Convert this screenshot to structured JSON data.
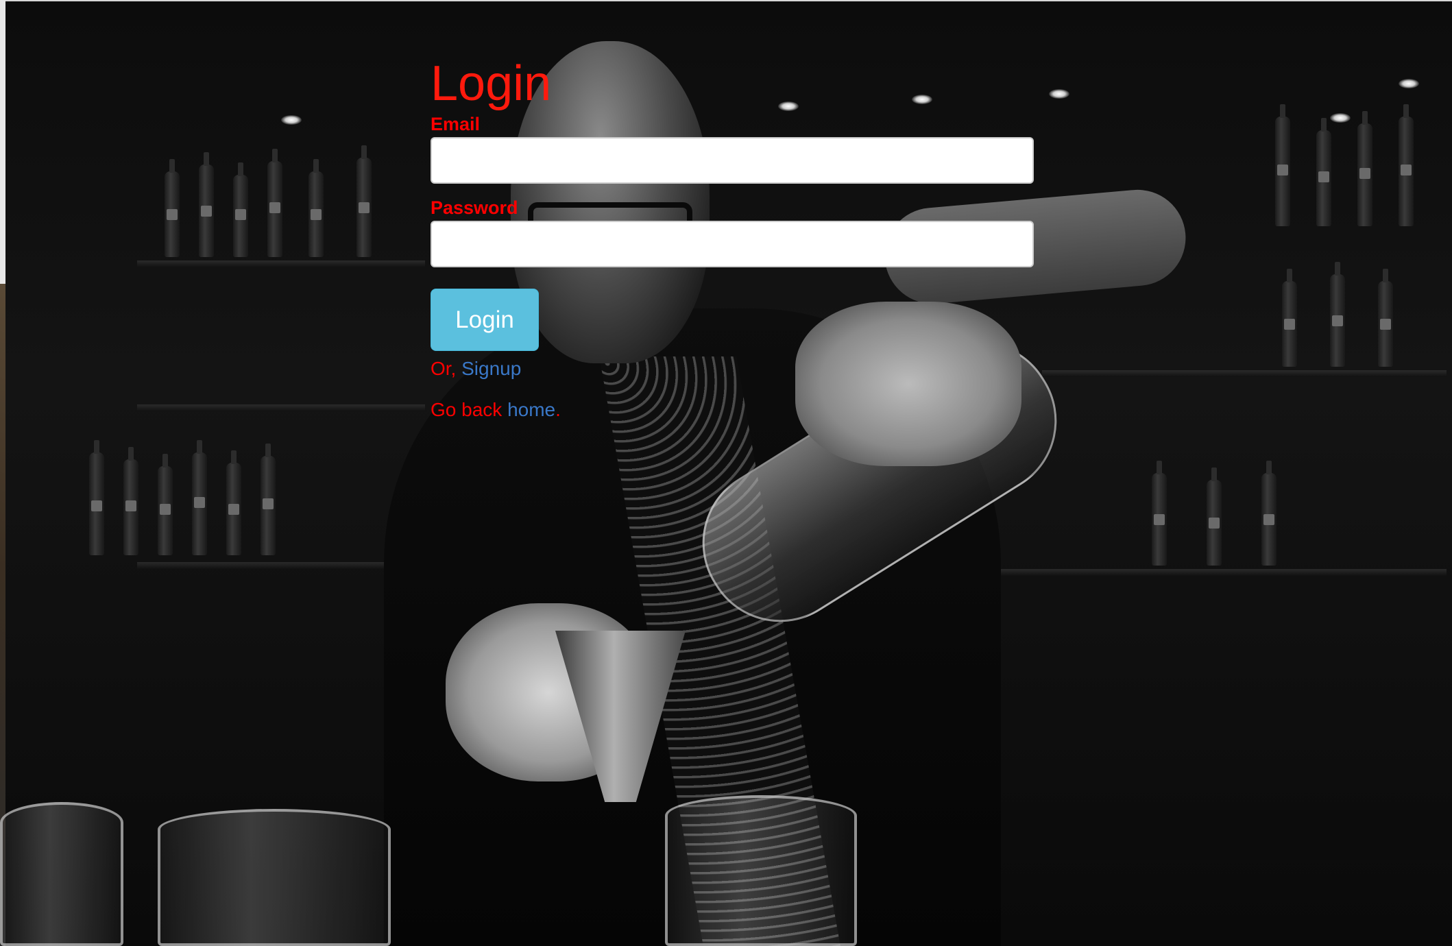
{
  "login": {
    "title": "Login",
    "email_label": "Email",
    "email_value": "",
    "password_label": "Password",
    "password_value": "",
    "submit_label": "Login",
    "signup_prefix": "Or,",
    "signup_link": "Signup",
    "home_prefix": "Go back",
    "home_link": "home",
    "home_suffix": "."
  },
  "colors": {
    "label_red": "#ff0000",
    "title_red": "#ff1a0d",
    "button_bg": "#5bc0de",
    "link_blue": "#3a78c8",
    "input_bg": "#ffffff"
  },
  "background": {
    "icon": "bartender-photo"
  }
}
